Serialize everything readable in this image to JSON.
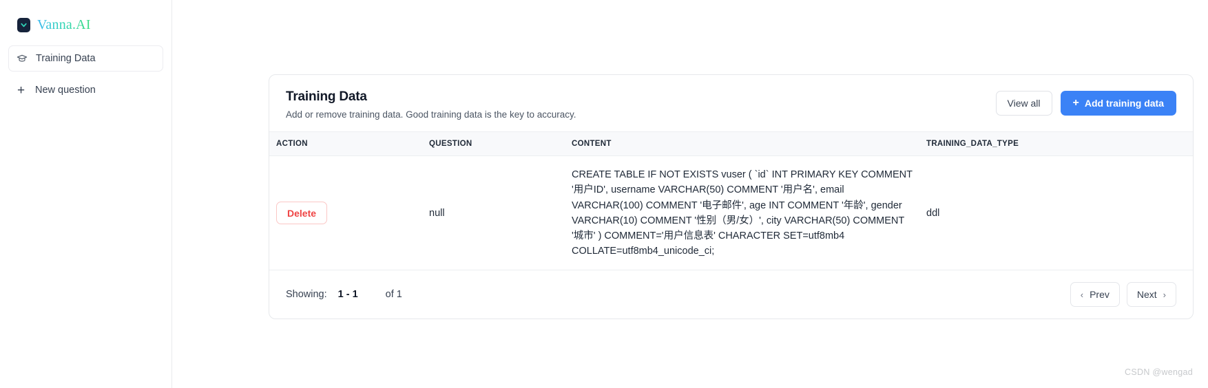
{
  "sidebar": {
    "brand": {
      "name": "Vanna.AI",
      "logo_icon": "chevron-down-badge-icon",
      "logo_bg": "#16233b",
      "logo_accent": "#2ed3b7",
      "gradient_from": "#3bb8f0",
      "gradient_to": "#3ddc84"
    },
    "items": [
      {
        "label": "Training Data",
        "icon": "graduation-cap-icon",
        "active": true
      },
      {
        "label": "New question",
        "icon": "plus-icon",
        "active": false,
        "glyph": "+"
      }
    ]
  },
  "card": {
    "title": "Training Data",
    "subtitle": "Add or remove training data. Good training data is the key to accuracy.",
    "actions": {
      "view_all_label": "View all",
      "add_training_data_label": "Add training data",
      "add_icon_glyph": "+",
      "primary_color": "#3b82f6"
    },
    "table": {
      "columns": [
        "ACTION",
        "QUESTION",
        "CONTENT",
        "TRAINING_DATA_TYPE"
      ],
      "rows": [
        {
          "action_label": "Delete",
          "action_color": "#ef4444",
          "question": "null",
          "content": "CREATE TABLE IF NOT EXISTS vuser ( `id` INT PRIMARY KEY COMMENT '用户ID', username VARCHAR(50) COMMENT '用户名', email VARCHAR(100) COMMENT '电子邮件', age INT COMMENT '年龄', gender VARCHAR(10) COMMENT '性别（男/女）', city VARCHAR(50) COMMENT '城市' ) COMMENT='用户信息表' CHARACTER SET=utf8mb4 COLLATE=utf8mb4_unicode_ci;",
          "training_data_type": "ddl"
        }
      ]
    },
    "footer": {
      "showing_label": "Showing:",
      "range": "1 - 1",
      "total": "of 1",
      "prev_label": "Prev",
      "next_label": "Next",
      "prev_icon": "chevron-left-icon",
      "next_icon": "chevron-right-icon"
    }
  },
  "watermark": {
    "text": "CSDN @wengad"
  }
}
